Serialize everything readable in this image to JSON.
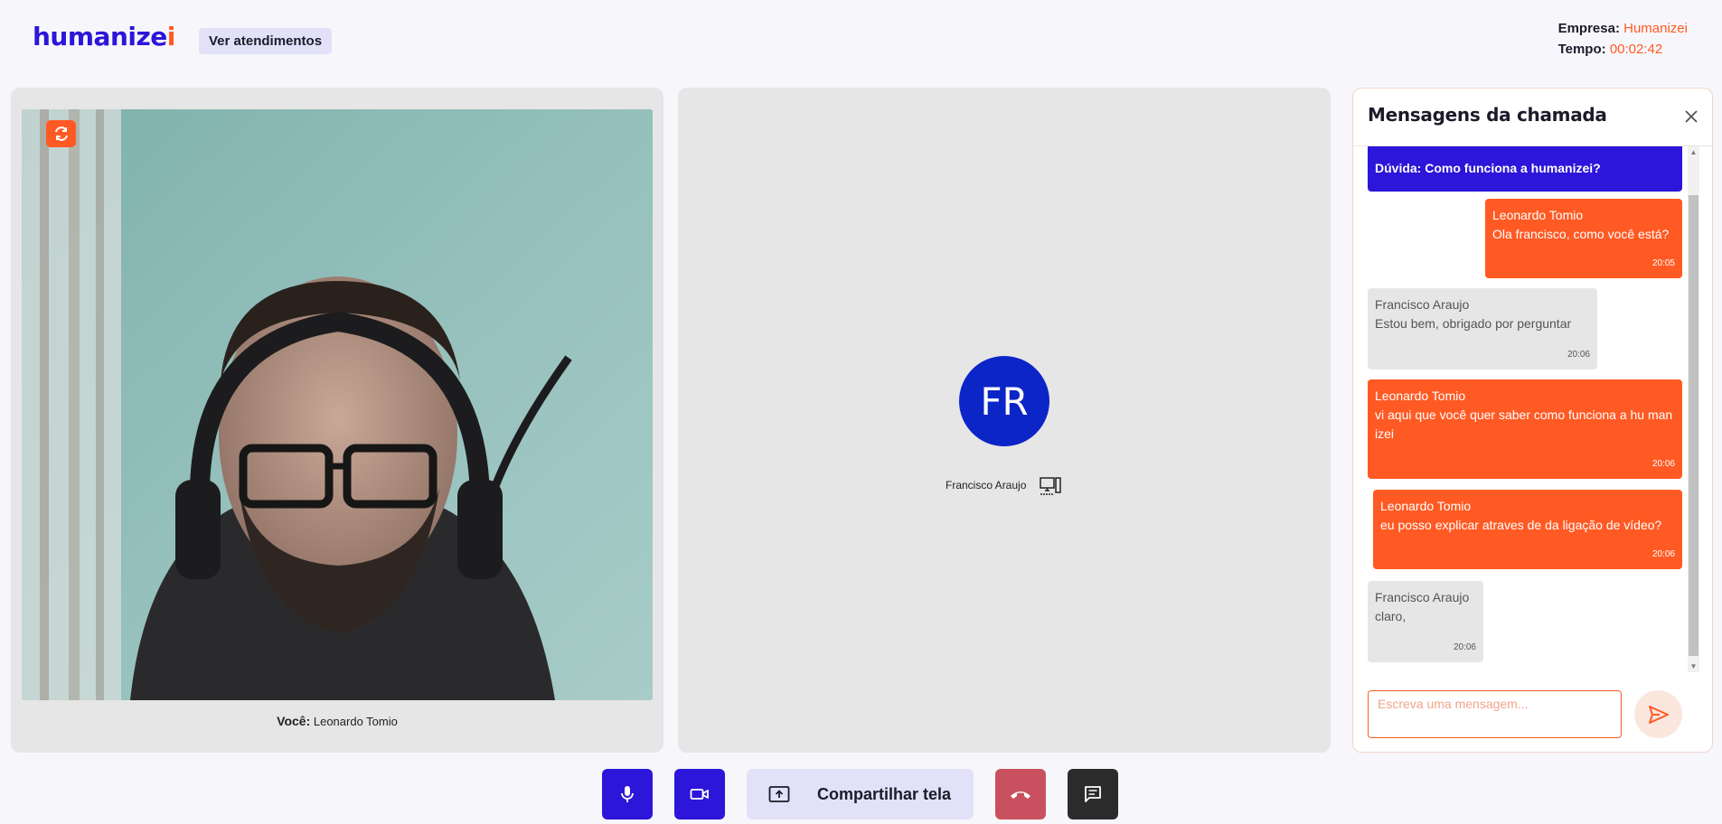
{
  "header": {
    "logo_main": "humanize",
    "logo_accent": "i",
    "ver_atendimentos": "Ver atendimentos",
    "empresa_label": "Empresa:",
    "empresa_value": "Humanizei",
    "tempo_label": "Tempo:",
    "tempo_value": "00:02:42"
  },
  "local": {
    "you_label": "Você:",
    "you_name": "Leonardo Tomio"
  },
  "remote": {
    "initials": "FR",
    "name": "Francisco Araujo"
  },
  "chat": {
    "title": "Mensagens da chamada",
    "input_placeholder": "Escreva uma mensagem...",
    "messages": [
      {
        "type": "sys",
        "author": "",
        "text": "Dúvida: Como funciona a humanizei?",
        "time": ""
      },
      {
        "type": "out",
        "author": "Leonardo Tomio",
        "text": "Ola francisco, como você está?",
        "time": "20:05"
      },
      {
        "type": "in",
        "author": "Francisco Araujo",
        "text": "Estou bem, obrigado por perguntar",
        "time": "20:06"
      },
      {
        "type": "out",
        "author": "Leonardo Tomio",
        "text": "vi aqui que você quer saber como funciona a hu manizei",
        "time": "20:06"
      },
      {
        "type": "out",
        "author": "Leonardo Tomio",
        "text": "eu posso explicar atraves de da ligação de vídeo?",
        "time": "20:06"
      },
      {
        "type": "in",
        "author": "Francisco Araujo",
        "text": "claro,",
        "time": "20:06"
      }
    ]
  },
  "controls": {
    "share_label": "Compartilhar tela",
    "icons": [
      "mic-icon",
      "video-camera-icon",
      "screen-share-icon",
      "hang-up-icon",
      "chat-icon"
    ]
  },
  "colors": {
    "primary": "#2b16d9",
    "accent": "#ff5a24",
    "hangup": "#c9515f",
    "avatar": "#0b25c7"
  }
}
